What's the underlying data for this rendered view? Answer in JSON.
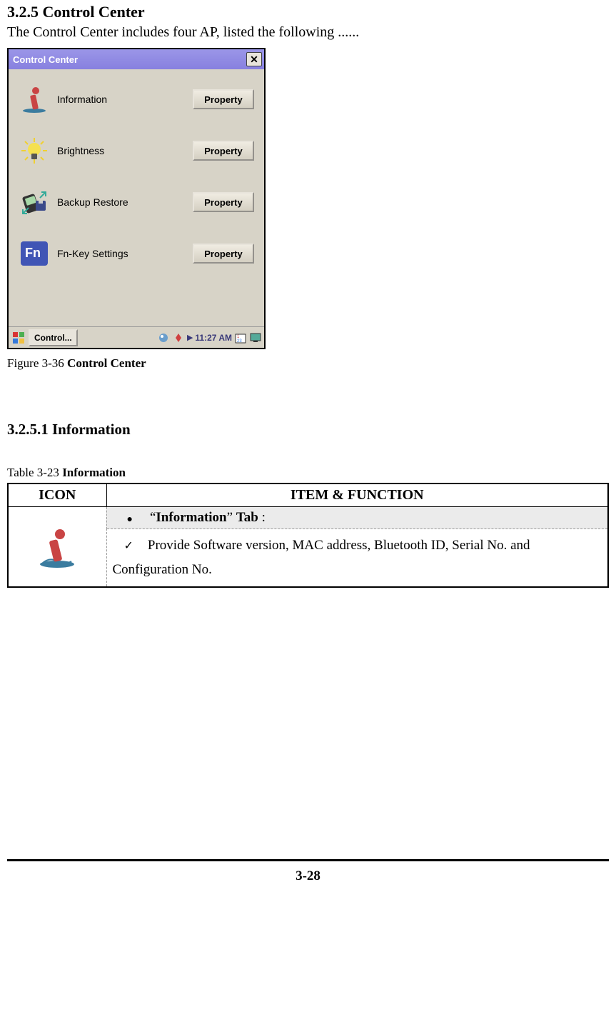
{
  "section": {
    "heading": "3.2.5 Control Center",
    "intro": "The Control Center includes four AP, listed the following ......"
  },
  "window": {
    "title": "Control Center",
    "close": "✕",
    "rows": [
      {
        "label": "Information",
        "button": "Property"
      },
      {
        "label": "Brightness",
        "button": "Property"
      },
      {
        "label": "Backup Restore",
        "button": "Property"
      },
      {
        "label": "Fn-Key Settings",
        "button": "Property"
      }
    ],
    "taskbar": {
      "task": "Control...",
      "clock": "11:27 AM"
    }
  },
  "figure_caption_prefix": "Figure 3-36 ",
  "figure_caption_bold": "Control Center",
  "subsection_heading": "3.2.5.1 Information",
  "table_caption_prefix": "Table 3-23 ",
  "table_caption_bold": "Information",
  "table": {
    "header_icon": "ICON",
    "header_item": "ITEM & FUNCTION",
    "tab_prefix": "“",
    "tab_bold": "Information",
    "tab_suffix": "” ",
    "tab_bold2": "Tab",
    "tab_colon": " :",
    "desc": "Provide Software version, MAC address, Bluetooth ID, Serial No. and Configuration No."
  },
  "page_num": "3-28"
}
